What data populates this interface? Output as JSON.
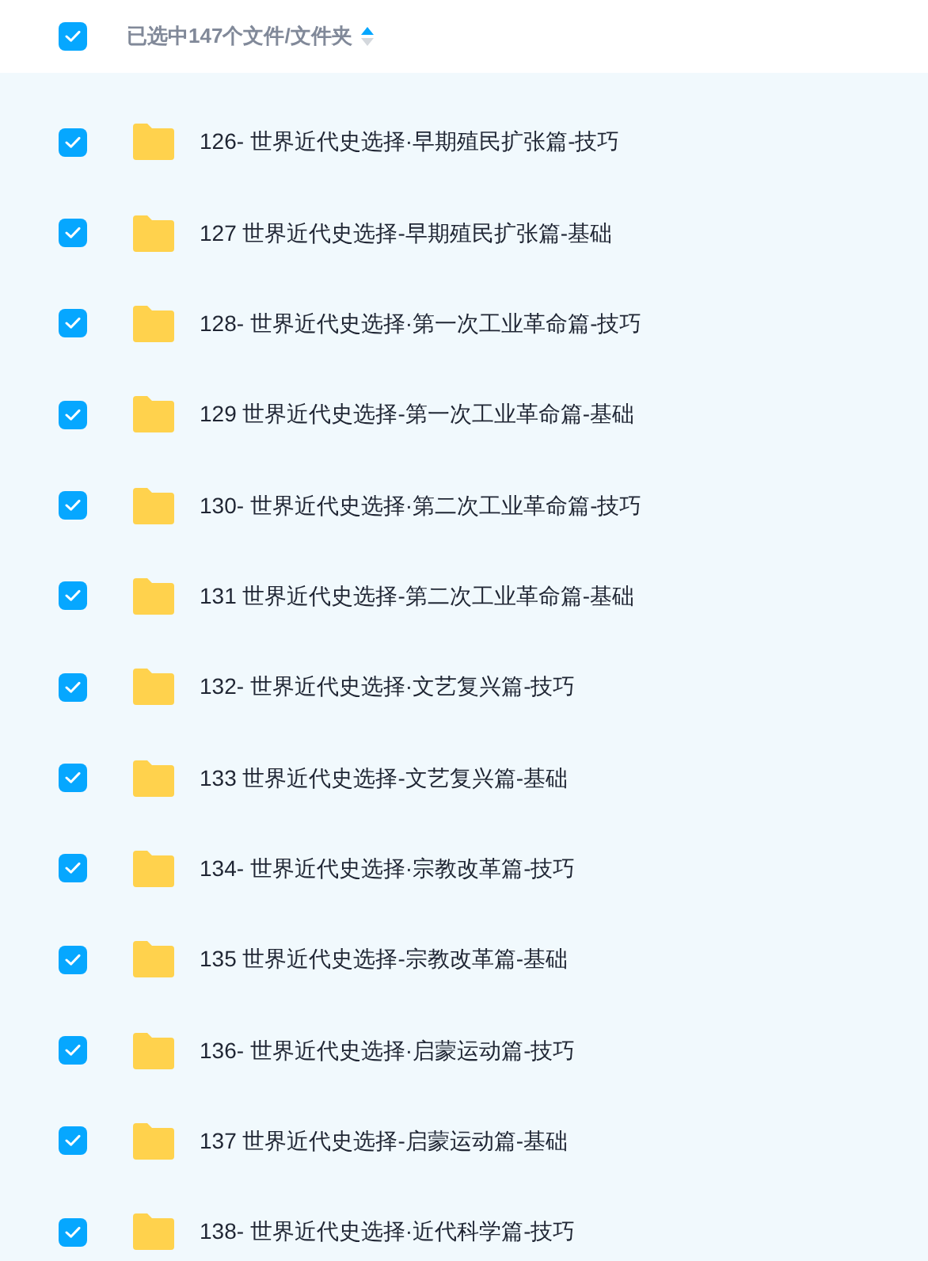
{
  "header": {
    "checked": true,
    "label": "已选中147个文件/文件夹"
  },
  "files": [
    {
      "name": "126- 世界近代史选择·早期殖民扩张篇-技巧",
      "checked": true
    },
    {
      "name": "127 世界近代史选择-早期殖民扩张篇-基础",
      "checked": true
    },
    {
      "name": "128- 世界近代史选择·第一次工业革命篇-技巧",
      "checked": true
    },
    {
      "name": "129 世界近代史选择-第一次工业革命篇-基础",
      "checked": true
    },
    {
      "name": "130- 世界近代史选择·第二次工业革命篇-技巧",
      "checked": true
    },
    {
      "name": "131 世界近代史选择-第二次工业革命篇-基础",
      "checked": true
    },
    {
      "name": "132- 世界近代史选择·文艺复兴篇-技巧",
      "checked": true
    },
    {
      "name": "133 世界近代史选择-文艺复兴篇-基础",
      "checked": true
    },
    {
      "name": "134- 世界近代史选择·宗教改革篇-技巧",
      "checked": true
    },
    {
      "name": "135 世界近代史选择-宗教改革篇-基础",
      "checked": true
    },
    {
      "name": "136- 世界近代史选择·启蒙运动篇-技巧",
      "checked": true
    },
    {
      "name": "137 世界近代史选择-启蒙运动篇-基础",
      "checked": true
    },
    {
      "name": "138- 世界近代史选择·近代科学篇-技巧",
      "checked": true
    }
  ]
}
